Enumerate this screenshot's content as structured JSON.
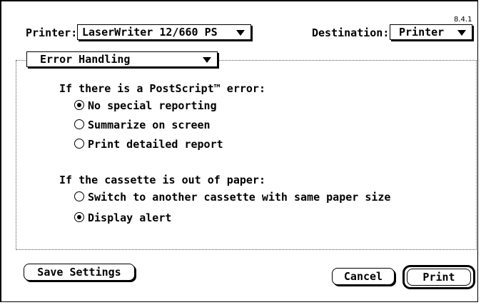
{
  "version": "8.4.1",
  "printer": {
    "label": "Printer:",
    "value": "LaserWriter 12/660 PS"
  },
  "destination": {
    "label": "Destination:",
    "value": "Printer"
  },
  "section_popup": {
    "value": "Error Handling"
  },
  "postscript_error": {
    "heading": "If there is a PostScript™ error:",
    "options": [
      {
        "label": "No special reporting",
        "checked": true
      },
      {
        "label": "Summarize on screen",
        "checked": false
      },
      {
        "label": "Print detailed report",
        "checked": false
      }
    ]
  },
  "cassette": {
    "heading": "If the cassette is out of paper:",
    "options": [
      {
        "label": "Switch to another cassette with same paper size",
        "checked": false
      },
      {
        "label": "Display alert",
        "checked": true
      }
    ]
  },
  "buttons": {
    "save": "Save Settings",
    "cancel": "Cancel",
    "print": "Print"
  }
}
